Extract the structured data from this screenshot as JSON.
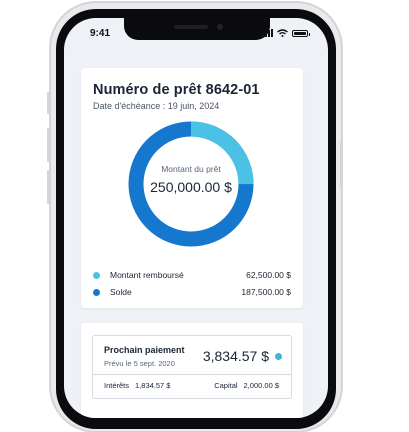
{
  "status_bar": {
    "time": "9:41"
  },
  "loan": {
    "title": "Numéro de prêt 8642-01",
    "due_date": "Date d'échéance : 19 juin, 2024",
    "donut_label": "Montant du prêt",
    "donut_value": "250,000.00 $",
    "repaid_fraction": 0.25,
    "legend": [
      {
        "label": "Montant remboursé",
        "amount": "62,500.00 $",
        "color": "#4cc1e6"
      },
      {
        "label": "Solde",
        "amount": "187,500.00 $",
        "color": "#1677cf"
      }
    ]
  },
  "payment": {
    "title": "Prochain paiement",
    "subtitle": "Prévu le 5 sept. 2020",
    "amount": "3,834.57 $",
    "interest_label": "Intérêts",
    "interest_value": "1,834.57 $",
    "capital_label": "Capital",
    "capital_value": "2,000.00 $",
    "info_icon": "info-dot-icon",
    "info_color": "#3fb3d8"
  }
}
